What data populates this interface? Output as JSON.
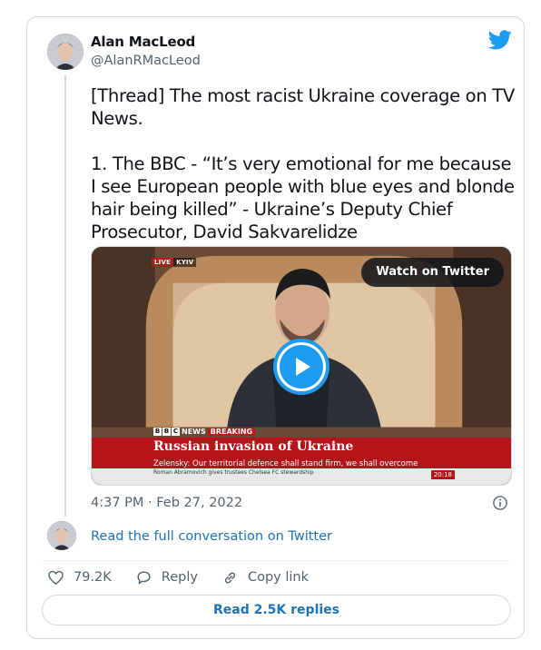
{
  "author": {
    "name": "Alan MacLeod",
    "handle": "@AlanRMacLeod"
  },
  "tweet": {
    "text": "[Thread] The most racist Ukraine coverage on TV News.\n\n1. The BBC - “It’s very emotional for me because I see European people with blue eyes and blonde hair being killed” - Ukraine’s Deputy Chief Prosecutor, David Sakvarelidze",
    "timestamp": "4:37 PM · Feb 27, 2022"
  },
  "media": {
    "watch_label": "Watch on Twitter",
    "live_label": "LIVE",
    "city_label": "KYIV",
    "bbc_news_label": "NEWS",
    "breaking_label": "BREAKING",
    "headline": "Russian invasion of Ukraine",
    "subline": "Zelensky: Our territorial defence shall stand firm, we shall overcome",
    "ticker": "Roman Abramovich gives trustees Chelsea FC stewardship",
    "clock": "20:18"
  },
  "links": {
    "read_conversation": "Read the full conversation on Twitter"
  },
  "actions": {
    "like_count": "79.2K",
    "reply_label": "Reply",
    "copy_link_label": "Copy link"
  },
  "replies_button": "Read 2.5K replies",
  "icons": {
    "brand": "twitter-bird-icon",
    "like": "heart-icon",
    "reply": "speech-bubble-icon",
    "copy_link": "link-icon",
    "info": "info-icon"
  },
  "colors": {
    "twitter_blue": "#1d9bf0",
    "link_blue": "#1d73b8",
    "muted": "#536471",
    "bbc_red": "#b4141a"
  }
}
